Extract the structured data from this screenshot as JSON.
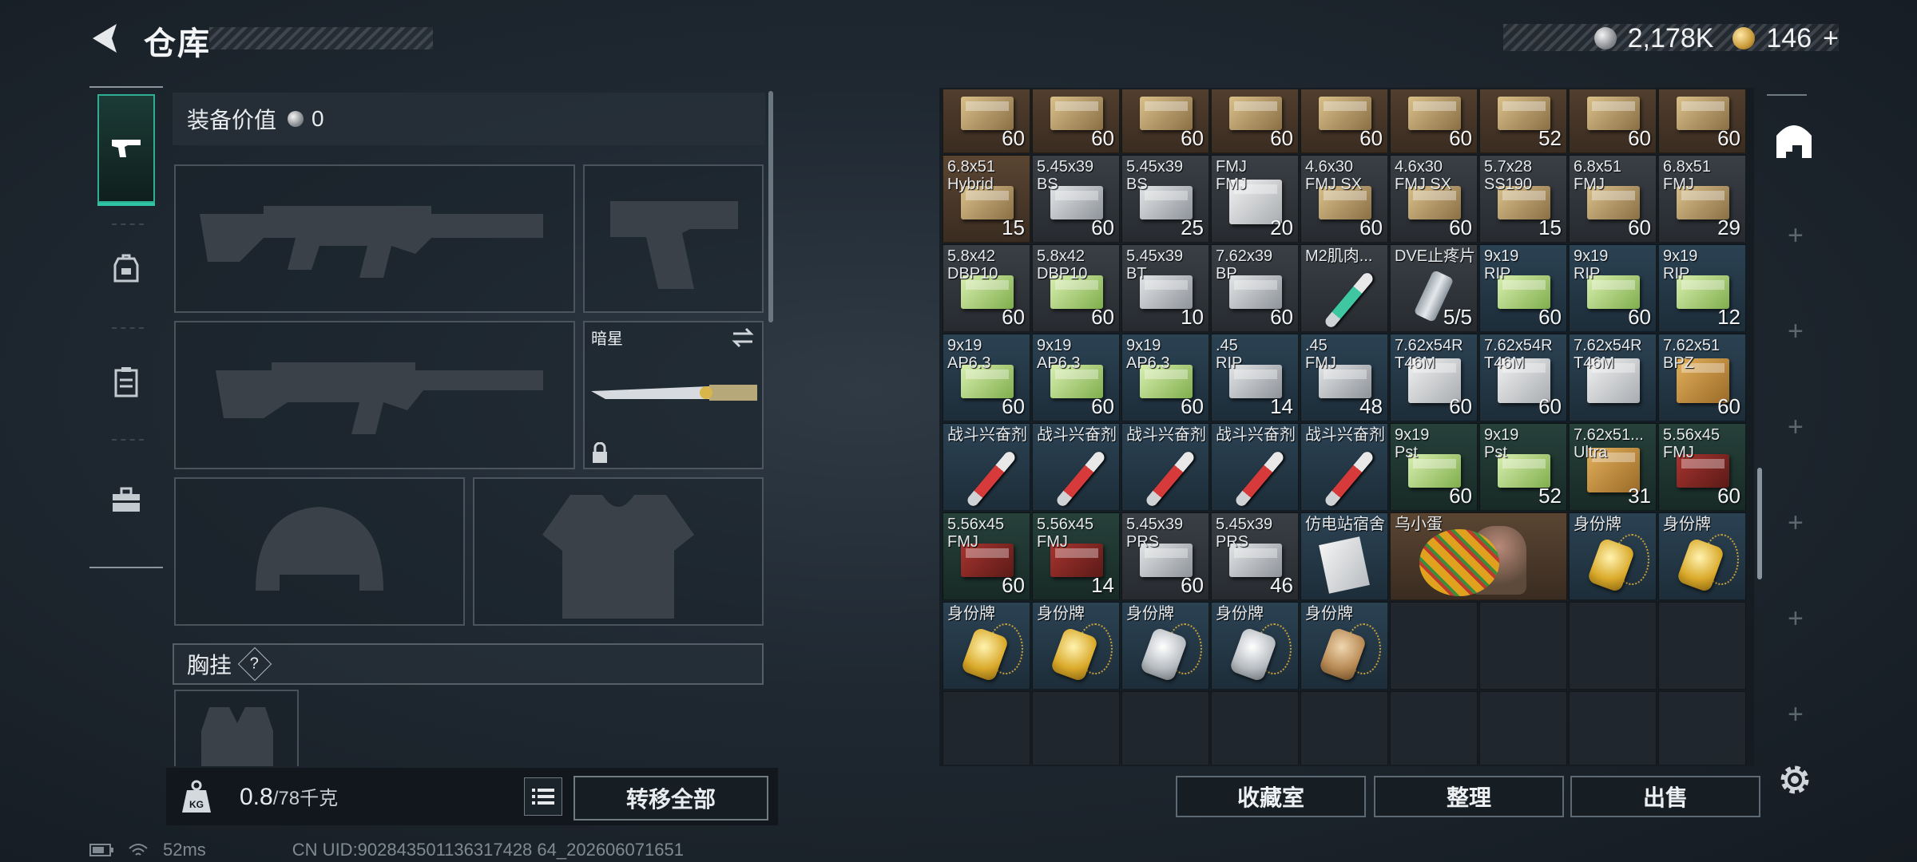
{
  "header": {
    "title": "仓库",
    "currency": [
      {
        "icon": "silver-coin-icon",
        "value": "2,178K"
      },
      {
        "icon": "gold-coin-icon",
        "value": "146"
      }
    ],
    "currency_add": "+"
  },
  "tabs": [
    {
      "icon": "pistol-icon",
      "active": true
    },
    {
      "icon": "backpack-icon",
      "active": false
    },
    {
      "icon": "clipboard-icon",
      "active": false
    },
    {
      "icon": "toolbox-icon",
      "active": false
    }
  ],
  "loadout": {
    "value_label": "装备价值",
    "value": "0",
    "melee_name": "暗星",
    "chest_label": "胸挂",
    "chest_help": "?"
  },
  "capacity": {
    "used": "0.8",
    "total": "/78千克"
  },
  "buttons": {
    "transfer_all": "转移全部",
    "collection": "收藏室",
    "sort": "整理",
    "sell": "出售"
  },
  "status": {
    "ping": "52ms",
    "uid": "CN UID:902843501136317428 64_202606071651"
  },
  "storage": {
    "items": [
      {
        "name": "",
        "count": "60",
        "bg": "brown",
        "icon": "gold"
      },
      {
        "name": "",
        "count": "60",
        "bg": "brown",
        "icon": "gold"
      },
      {
        "name": "",
        "count": "60",
        "bg": "brown",
        "icon": "gold"
      },
      {
        "name": "",
        "count": "60",
        "bg": "brown",
        "icon": "gold"
      },
      {
        "name": "",
        "count": "60",
        "bg": "brown",
        "icon": "gold"
      },
      {
        "name": "",
        "count": "60",
        "bg": "brown",
        "icon": "gold"
      },
      {
        "name": "",
        "count": "52",
        "bg": "brown",
        "icon": "gold"
      },
      {
        "name": "",
        "count": "60",
        "bg": "brown",
        "icon": "gold"
      },
      {
        "name": "",
        "count": "60",
        "bg": "brown",
        "icon": "gold"
      },
      {
        "name": "6.8x51\nHybrid",
        "count": "15",
        "bg": "brown",
        "icon": "gold"
      },
      {
        "name": "5.45x39\nBS",
        "count": "60",
        "bg": "gray",
        "icon": "silver"
      },
      {
        "name": "5.45x39\nBS",
        "count": "25",
        "bg": "gray",
        "icon": "silver"
      },
      {
        "name": "FMJ\nFMJ",
        "count": "20",
        "bg": "gray",
        "icon": "white"
      },
      {
        "name": "4.6x30\nFMJ SX",
        "count": "60",
        "bg": "gray",
        "icon": "gold"
      },
      {
        "name": "4.6x30\nFMJ SX",
        "count": "60",
        "bg": "gray",
        "icon": "gold"
      },
      {
        "name": "5.7x28\nSS190",
        "count": "15",
        "bg": "gray",
        "icon": "gold"
      },
      {
        "name": "6.8x51\nFMJ",
        "count": "60",
        "bg": "gray",
        "icon": "gold"
      },
      {
        "name": "6.8x51\nFMJ",
        "count": "29",
        "bg": "gray",
        "icon": "gold"
      },
      {
        "name": "5.8x42\nDBP10",
        "count": "60",
        "bg": "gray",
        "icon": "green"
      },
      {
        "name": "5.8x42\nDBP10",
        "count": "60",
        "bg": "gray",
        "icon": "green"
      },
      {
        "name": "5.45x39\nBT",
        "count": "10",
        "bg": "gray",
        "icon": "silver"
      },
      {
        "name": "7.62x39\nBP",
        "count": "60",
        "bg": "gray",
        "icon": "silver"
      },
      {
        "name": "M2肌肉...",
        "count": "",
        "bg": "gray",
        "icon": "syringe-teal"
      },
      {
        "name": "DVE止疼片",
        "count": "5/5",
        "bg": "gray",
        "icon": "canister"
      },
      {
        "name": "9x19\nRIP",
        "count": "60",
        "bg": "blue",
        "icon": "green"
      },
      {
        "name": "9x19\nRIP",
        "count": "60",
        "bg": "blue",
        "icon": "green"
      },
      {
        "name": "9x19\nRIP",
        "count": "12",
        "bg": "blue",
        "icon": "green"
      },
      {
        "name": "9x19\nAP6.3",
        "count": "60",
        "bg": "blue",
        "icon": "green"
      },
      {
        "name": "9x19\nAP6.3",
        "count": "60",
        "bg": "blue",
        "icon": "green"
      },
      {
        "name": "9x19\nAP6.3",
        "count": "60",
        "bg": "blue",
        "icon": "green"
      },
      {
        "name": ".45\nRIP",
        "count": "14",
        "bg": "blue",
        "icon": "silver"
      },
      {
        "name": ".45\nFMJ",
        "count": "48",
        "bg": "blue",
        "icon": "silver"
      },
      {
        "name": "7.62x54R\nT46M",
        "count": "60",
        "bg": "blue",
        "icon": "white"
      },
      {
        "name": "7.62x54R\nT46M",
        "count": "60",
        "bg": "blue",
        "icon": "white"
      },
      {
        "name": "7.62x54R\nT46M",
        "count": "",
        "bg": "blue",
        "icon": "white"
      },
      {
        "name": "7.62x51\nBPZ",
        "count": "60",
        "bg": "blue",
        "icon": "orange"
      },
      {
        "name": "战斗兴奋剂",
        "count": "",
        "bg": "blue",
        "icon": "syringe"
      },
      {
        "name": "战斗兴奋剂",
        "count": "",
        "bg": "blue",
        "icon": "syringe"
      },
      {
        "name": "战斗兴奋剂",
        "count": "",
        "bg": "blue",
        "icon": "syringe"
      },
      {
        "name": "战斗兴奋剂",
        "count": "",
        "bg": "blue",
        "icon": "syringe"
      },
      {
        "name": "战斗兴奋剂",
        "count": "",
        "bg": "blue",
        "icon": "syringe"
      },
      {
        "name": "9x19\nPst",
        "count": "60",
        "bg": "green",
        "icon": "green"
      },
      {
        "name": "9x19\nPst",
        "count": "52",
        "bg": "green",
        "icon": "green"
      },
      {
        "name": "7.62x51...\nUltra",
        "count": "31",
        "bg": "green",
        "icon": "orange"
      },
      {
        "name": "5.56x45\nFMJ",
        "count": "60",
        "bg": "green",
        "icon": "darkred"
      },
      {
        "name": "5.56x45\nFMJ",
        "count": "60",
        "bg": "green",
        "icon": "darkred"
      },
      {
        "name": "5.56x45\nFMJ",
        "count": "14",
        "bg": "green",
        "icon": "darkred"
      },
      {
        "name": "5.45x39\nPRS",
        "count": "60",
        "bg": "gray",
        "icon": "silver"
      },
      {
        "name": "5.45x39\nPRS",
        "count": "46",
        "bg": "gray",
        "icon": "silver"
      },
      {
        "name": "仿电站宿舍",
        "count": "",
        "bg": "blue",
        "icon": "note"
      },
      {
        "name": "乌小蛋",
        "count": "",
        "bg": "brown",
        "icon": "egg"
      },
      {
        "name": "身份牌",
        "count": "",
        "bg": "blue",
        "icon": "tag-gold"
      },
      {
        "name": "身份牌",
        "count": "",
        "bg": "blue",
        "icon": "tag-gold"
      },
      {
        "name": "身份牌",
        "count": "",
        "bg": "blue",
        "icon": "tag-gold"
      },
      {
        "name": "身份牌",
        "count": "",
        "bg": "blue",
        "icon": "tag-gold"
      },
      {
        "name": "身份牌",
        "count": "",
        "bg": "blue",
        "icon": "tag-silver"
      },
      {
        "name": "身份牌",
        "count": "",
        "bg": "blue",
        "icon": "tag-silver"
      },
      {
        "name": "身份牌",
        "count": "",
        "bg": "blue",
        "icon": "tag-bronze"
      }
    ]
  }
}
